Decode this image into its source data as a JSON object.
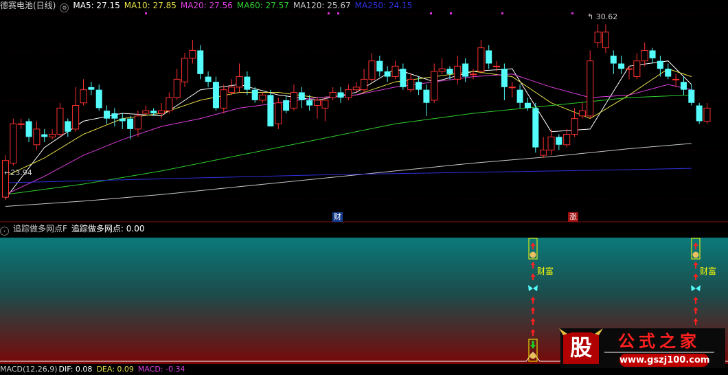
{
  "main_header": {
    "stock_name": "德赛电池(日线)",
    "ma5_label": "MA5: 27.15",
    "ma10_label": "MA10: 27.85",
    "ma20_label": "MA20: 27.56",
    "ma60_label": "MA60: 27.57",
    "ma120_label": "MA120: 25.67",
    "ma250_label": "MA250: 24.15"
  },
  "indicator_header": {
    "name": "追踪做多网点F",
    "value_label": "追踪做多网点: 0.00"
  },
  "macd_header": {
    "name": "MACD(12,26,9)",
    "dif_label": "DIF: 0.08",
    "dea_label": "DEA: 0.09",
    "macd_label": "MACD: -0.34"
  },
  "markers": {
    "low_label": "23.94",
    "high_label": "30.62",
    "finance_tag": "财",
    "limit_tag": "涨",
    "signal_text": "财富"
  },
  "watermark": {
    "logo_char": "股",
    "brand": "公式之家",
    "url": "www.gszj100.com"
  },
  "colors": {
    "ma5": "#ffffff",
    "ma10": "#e8e04a",
    "ma20": "#e040e0",
    "ma60": "#2fcf2f",
    "ma120": "#c8c8c8",
    "ma250": "#3030e0",
    "up_candle": "#ff3030",
    "down_candle": "#54fcfc",
    "signal_arrow": "#ff2020",
    "signal_text": "#ffff00"
  },
  "chart_data": {
    "type": "candlestick",
    "title": "德赛电池(日线)",
    "price_range": [
      23.4,
      31.0
    ],
    "candles": [
      [
        24.0,
        25.4,
        25.6,
        23.9
      ],
      [
        25.3,
        26.8,
        27.0,
        25.2
      ],
      [
        26.8,
        26.8,
        27.0,
        26.6
      ],
      [
        26.9,
        26.3,
        27.0,
        26.1
      ],
      [
        26.0,
        26.6,
        26.9,
        25.8
      ],
      [
        26.4,
        26.3,
        26.6,
        26.1
      ],
      [
        26.3,
        26.4,
        26.6,
        26.2
      ],
      [
        26.4,
        27.4,
        27.6,
        26.3
      ],
      [
        26.9,
        26.5,
        27.0,
        26.3
      ],
      [
        26.6,
        27.5,
        28.2,
        26.5
      ],
      [
        27.6,
        28.1,
        28.5,
        27.5
      ],
      [
        28.2,
        28.1,
        28.4,
        27.9
      ],
      [
        28.1,
        27.4,
        28.3,
        27.3
      ],
      [
        27.3,
        27.0,
        27.5,
        26.8
      ],
      [
        27.2,
        27.0,
        27.4,
        26.7
      ],
      [
        27.0,
        26.9,
        27.2,
        26.6
      ],
      [
        27.0,
        26.6,
        27.1,
        26.2
      ],
      [
        26.6,
        27.1,
        27.3,
        26.3
      ],
      [
        27.2,
        27.3,
        27.5,
        27.1
      ],
      [
        27.3,
        27.2,
        27.4,
        27.1
      ],
      [
        27.2,
        27.3,
        27.6,
        27.0
      ],
      [
        27.3,
        27.8,
        28.0,
        27.2
      ],
      [
        27.8,
        28.5,
        28.9,
        27.7
      ],
      [
        28.4,
        29.3,
        29.5,
        28.2
      ],
      [
        29.3,
        29.6,
        30.0,
        29.1
      ],
      [
        29.6,
        28.7,
        29.8,
        28.5
      ],
      [
        28.6,
        28.4,
        28.8,
        28.2
      ],
      [
        28.4,
        27.4,
        28.6,
        27.3
      ],
      [
        27.4,
        28.1,
        28.3,
        27.2
      ],
      [
        28.0,
        28.2,
        28.5,
        27.9
      ],
      [
        28.2,
        28.6,
        29.1,
        28.0
      ],
      [
        28.6,
        28.1,
        28.8,
        27.9
      ],
      [
        28.1,
        27.7,
        28.2,
        27.6
      ],
      [
        27.7,
        27.9,
        28.0,
        27.6
      ],
      [
        27.9,
        26.7,
        28.1,
        26.7
      ],
      [
        26.8,
        27.6,
        27.8,
        26.6
      ],
      [
        27.7,
        27.3,
        27.9,
        27.2
      ],
      [
        27.4,
        28.0,
        28.3,
        27.3
      ],
      [
        28.0,
        27.7,
        28.2,
        27.4
      ],
      [
        27.7,
        27.5,
        27.9,
        27.3
      ],
      [
        27.5,
        27.7,
        27.8,
        27.0
      ],
      [
        27.4,
        27.7,
        27.8,
        26.9
      ],
      [
        27.8,
        28.0,
        28.2,
        27.7
      ],
      [
        28.0,
        27.8,
        28.2,
        27.6
      ],
      [
        27.8,
        28.1,
        28.3,
        27.7
      ],
      [
        28.1,
        28.2,
        28.4,
        28.0
      ],
      [
        28.1,
        28.5,
        28.9,
        28.0
      ],
      [
        28.5,
        29.2,
        29.5,
        28.4
      ],
      [
        29.2,
        28.8,
        29.4,
        28.6
      ],
      [
        28.8,
        28.6,
        29.0,
        28.4
      ],
      [
        28.6,
        29.0,
        29.2,
        28.5
      ],
      [
        28.9,
        28.2,
        29.1,
        28.1
      ],
      [
        28.1,
        28.5,
        28.7,
        28.0
      ],
      [
        28.4,
        28.1,
        28.6,
        27.9
      ],
      [
        28.1,
        27.6,
        28.3,
        27.1
      ],
      [
        27.7,
        28.8,
        29.1,
        27.6
      ],
      [
        28.8,
        28.9,
        29.3,
        28.7
      ],
      [
        28.9,
        28.7,
        29.0,
        28.5
      ],
      [
        28.5,
        29.0,
        29.4,
        28.3
      ],
      [
        29.1,
        28.6,
        29.3,
        28.4
      ],
      [
        28.7,
        28.7,
        28.9,
        28.5
      ],
      [
        28.8,
        29.7,
        30.0,
        28.7
      ],
      [
        29.6,
        29.1,
        29.8,
        28.9
      ],
      [
        29.0,
        29.0,
        29.2,
        28.8
      ],
      [
        28.9,
        28.2,
        29.1,
        27.7
      ],
      [
        28.2,
        28.2,
        28.4,
        27.8
      ],
      [
        28.1,
        27.6,
        28.3,
        27.4
      ],
      [
        27.6,
        27.4,
        27.8,
        27.3
      ],
      [
        27.4,
        25.9,
        27.6,
        25.7
      ],
      [
        25.6,
        25.8,
        26.3,
        25.5
      ],
      [
        25.8,
        26.3,
        26.6,
        25.6
      ],
      [
        26.3,
        26.0,
        26.4,
        25.8
      ],
      [
        26.0,
        26.4,
        26.6,
        25.9
      ],
      [
        26.4,
        27.0,
        27.4,
        26.3
      ],
      [
        27.1,
        27.3,
        27.6,
        27.0
      ],
      [
        27.1,
        29.2,
        29.6,
        27.0
      ],
      [
        29.9,
        30.3,
        30.6,
        29.7
      ],
      [
        29.7,
        30.3,
        30.6,
        29.5
      ],
      [
        29.4,
        29.1,
        29.6,
        28.7
      ],
      [
        29.1,
        28.9,
        29.4,
        28.7
      ],
      [
        28.9,
        28.9,
        29.0,
        28.5
      ],
      [
        28.6,
        29.2,
        29.5,
        28.5
      ],
      [
        29.2,
        29.6,
        29.9,
        29.0
      ],
      [
        29.6,
        29.3,
        29.7,
        29.1
      ],
      [
        29.2,
        28.9,
        29.4,
        28.6
      ],
      [
        28.9,
        28.6,
        29.1,
        28.5
      ],
      [
        28.5,
        28.5,
        28.7,
        28.2
      ],
      [
        28.4,
        28.1,
        28.6,
        27.9
      ],
      [
        28.1,
        27.6,
        28.3,
        27.5
      ],
      [
        27.5,
        26.9,
        27.6,
        26.8
      ],
      [
        26.9,
        27.4,
        27.6,
        26.8
      ]
    ],
    "ma_series": [
      {
        "name": "MA5",
        "values": [
          [
            0,
            23.95
          ],
          [
            5,
            25.9
          ],
          [
            10,
            26.9
          ],
          [
            15,
            27.2
          ],
          [
            20,
            27.1
          ],
          [
            25,
            28.1
          ],
          [
            30,
            28.3
          ],
          [
            35,
            27.9
          ],
          [
            40,
            27.7
          ],
          [
            45,
            28.0
          ],
          [
            50,
            28.9
          ],
          [
            55,
            28.4
          ],
          [
            60,
            28.8
          ],
          [
            65,
            28.9
          ],
          [
            70,
            26.5
          ],
          [
            75,
            26.6
          ],
          [
            80,
            29.0
          ],
          [
            85,
            29.2
          ],
          [
            88,
            28.3
          ]
        ]
      },
      {
        "name": "MA10",
        "values": [
          [
            0,
            24.8
          ],
          [
            5,
            25.5
          ],
          [
            10,
            26.4
          ],
          [
            15,
            27.0
          ],
          [
            20,
            27.2
          ],
          [
            25,
            27.7
          ],
          [
            30,
            28.0
          ],
          [
            35,
            28.0
          ],
          [
            40,
            27.8
          ],
          [
            45,
            27.9
          ],
          [
            50,
            28.4
          ],
          [
            55,
            28.6
          ],
          [
            60,
            28.8
          ],
          [
            65,
            28.6
          ],
          [
            70,
            27.6
          ],
          [
            75,
            27.0
          ],
          [
            80,
            27.9
          ],
          [
            85,
            28.9
          ],
          [
            88,
            28.6
          ]
        ]
      },
      {
        "name": "MA20",
        "values": [
          [
            0,
            24.1
          ],
          [
            5,
            24.8
          ],
          [
            10,
            25.6
          ],
          [
            15,
            26.2
          ],
          [
            20,
            26.7
          ],
          [
            25,
            27.0
          ],
          [
            30,
            27.4
          ],
          [
            35,
            27.6
          ],
          [
            40,
            27.8
          ],
          [
            45,
            27.9
          ],
          [
            50,
            28.2
          ],
          [
            55,
            28.4
          ],
          [
            60,
            28.6
          ],
          [
            65,
            28.7
          ],
          [
            70,
            28.2
          ],
          [
            75,
            27.8
          ],
          [
            80,
            27.9
          ],
          [
            85,
            28.3
          ],
          [
            88,
            28.1
          ]
        ]
      },
      {
        "name": "MA60",
        "values": [
          [
            0,
            24.1
          ],
          [
            10,
            24.5
          ],
          [
            20,
            25.0
          ],
          [
            30,
            25.6
          ],
          [
            40,
            26.2
          ],
          [
            50,
            26.8
          ],
          [
            60,
            27.2
          ],
          [
            70,
            27.5
          ],
          [
            80,
            27.8
          ],
          [
            88,
            27.9
          ]
        ]
      },
      {
        "name": "MA120",
        "values": [
          [
            0,
            23.65
          ],
          [
            10,
            23.85
          ],
          [
            20,
            24.1
          ],
          [
            30,
            24.4
          ],
          [
            40,
            24.7
          ],
          [
            50,
            25.0
          ],
          [
            60,
            25.3
          ],
          [
            70,
            25.55
          ],
          [
            80,
            25.85
          ],
          [
            88,
            26.05
          ]
        ]
      },
      {
        "name": "MA250",
        "values": [
          [
            0,
            24.55
          ],
          [
            20,
            24.7
          ],
          [
            40,
            24.85
          ],
          [
            60,
            24.95
          ],
          [
            80,
            25.05
          ],
          [
            88,
            25.1
          ]
        ]
      }
    ],
    "annotations": [
      {
        "text": "23.94",
        "x": 0,
        "y": 23.94
      },
      {
        "text": "30.62",
        "x": 76,
        "y": 30.62
      },
      {
        "text": "财",
        "x": 44
      },
      {
        "text": "涨",
        "x": 75
      }
    ]
  }
}
